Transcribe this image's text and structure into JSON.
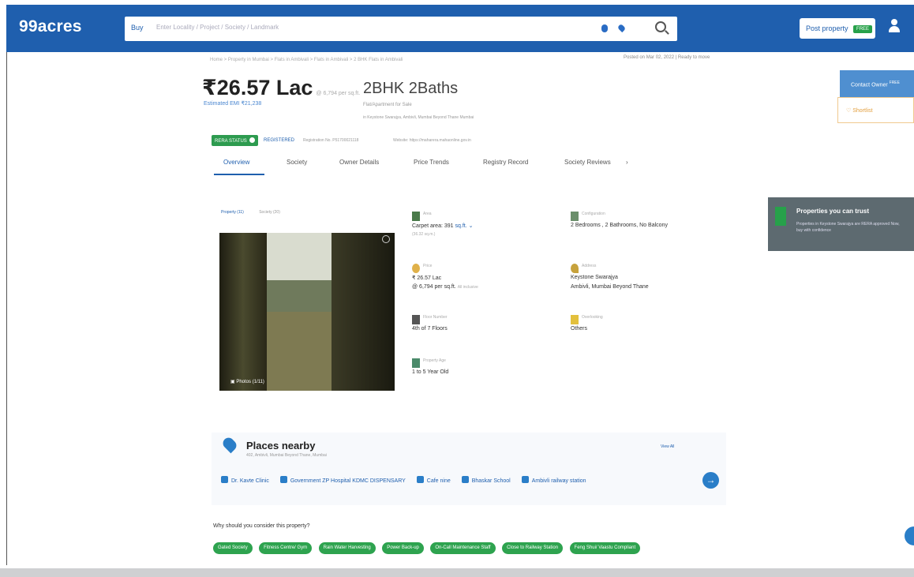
{
  "header": {
    "logo": "99acres",
    "search": {
      "type": "Buy",
      "placeholder": "Enter Locality / Project / Society / Landmark"
    },
    "post_property": "Post property",
    "free_tag": "FREE"
  },
  "listing": {
    "breadcrumb": "Home > Property in Mumbai > Flats in Ambivali > Flats in Ambivali > 2 BHK Flats in Ambivali",
    "posted": "Posted on Mar 02, 2022 | Ready to move",
    "price": "₹26.57 Lac",
    "price_per_sqft": "@ 6,794 per sq.ft.",
    "emi": "Estimated EMI ₹21,238",
    "title": "2BHK 2Baths",
    "subtitle": "Flat/Apartment for Sale",
    "address": "in Keystone Swarajya, Ambivli, Mumbai Beyond Thane Mumbai",
    "rera_label": "RERA STATUS",
    "rera_more": "REGISTERED",
    "rera_reg": "Registration No. P51700021118",
    "rera_site": "Website: https://maharera.mahaonline.gov.in"
  },
  "tabs": [
    {
      "label": "Overview"
    },
    {
      "label": "Society"
    },
    {
      "label": "Owner Details"
    },
    {
      "label": "Price Trends"
    },
    {
      "label": "Registry Record"
    },
    {
      "label": "Society Reviews"
    }
  ],
  "actions": {
    "contact": "Contact Owner",
    "contact_badge": "FREE",
    "shortlist": "Shortlist"
  },
  "trust": {
    "title": "Properties you can trust",
    "text": "Properties in Keystone Swarajya are RERA approved Now, buy with confidence"
  },
  "gallery": {
    "tab_property": "Property (11)",
    "tab_society": "Society (20)",
    "photos_label": "Photos (1/11)"
  },
  "details": {
    "area_label": "Area",
    "area_value": "Carpet area: 391",
    "area_unit": "sq.ft.",
    "area_sub": "(36.32 sq.m.)",
    "config_label": "Configuration",
    "config_value": "2 Bedrooms , 2 Bathrooms, No Balcony",
    "price_label": "Price",
    "price_value": "₹ 26.57 Lac",
    "price_sqft": "@ 6,794 per sq.ft.",
    "price_incl": "All inclusive",
    "address_label": "Address",
    "address_value1": "Keystone Swarajya",
    "address_value2": "Ambivli, Mumbai Beyond Thane",
    "floor_label": "Floor Number",
    "floor_value": "4th of 7 Floors",
    "facing_label": "Overlooking",
    "facing_value": "Others",
    "age_label": "Property Age",
    "age_value": "1 to 5 Year Old"
  },
  "places": {
    "title": "Places nearby",
    "subtitle": "402, Ambivli, Mumbai Beyond Thane, Mumbai",
    "view_all": "View All",
    "items": [
      {
        "label": "Dr. Kavte Clinic"
      },
      {
        "label": "Government ZP Hospital KDMC DISPENSARY"
      },
      {
        "label": "Cafe nine"
      },
      {
        "label": "Bhaskar School"
      },
      {
        "label": "Ambivli railway station"
      }
    ]
  },
  "why": {
    "title": "Why should you consider this property?",
    "chips": [
      {
        "label": "Gated Society"
      },
      {
        "label": "Fitness Centre/ Gym"
      },
      {
        "label": "Rain Water Harvesting"
      },
      {
        "label": "Power Back-up"
      },
      {
        "label": "On-Call Maintenance Staff"
      },
      {
        "label": "Close to Railway Station"
      },
      {
        "label": "Feng Shui/ Vaastu Compliant"
      }
    ]
  },
  "colors": {
    "brand_blue": "#1f5fae",
    "green": "#2ea34f",
    "trust_bg": "#5d6a70"
  }
}
